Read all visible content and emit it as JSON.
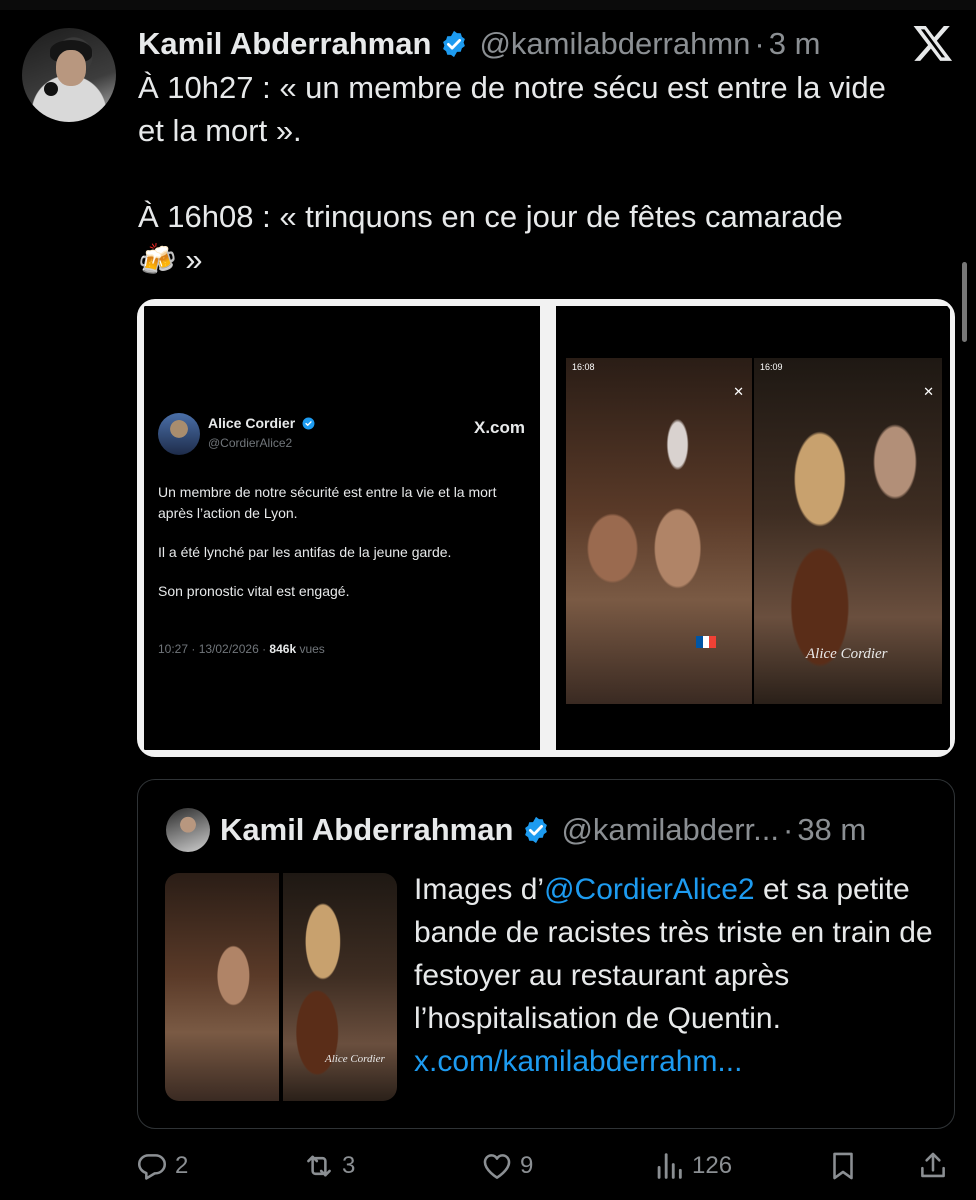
{
  "tweet": {
    "author_name": "Kamil Abderrahman",
    "handle": "@kamilabderrahmn",
    "separator": "·",
    "time": "3 m",
    "text_line1": "À 10h27 : « un membre de notre sécu est entre la vide",
    "text_line2": "et la mort ».",
    "text_line3": "À 16h08 : « trinquons en ce jour de fêtes camarade",
    "text_line4": "🍻 »"
  },
  "media": {
    "left_card": {
      "author_name": "Alice Cordier",
      "handle": "@CordierAlice2",
      "source": "X.com",
      "paragraph1": "Un membre de notre sécurité est entre la vie et la mort après l’action de Lyon.",
      "paragraph2": "Il a été lynché par les antifas de la jeune garde.",
      "paragraph3": "Son pronostic vital est engagé.",
      "meta_prefix": "10:27 · 13/02/2026 · ",
      "views_count": "846k",
      "views_suffix": " vues"
    },
    "right_photos": {
      "story_time_a": "16:08",
      "story_time_b": "16:09",
      "watermark": "Alice Cordier"
    }
  },
  "quoted_tweet": {
    "author_name": "Kamil Abderrahman",
    "handle": "@kamilabderr...",
    "separator": "·",
    "time": "38 m",
    "text_prefix": "Images d’",
    "mention": "@CordierAlice2",
    "text_rest": " et sa petite bande de racistes très triste en train de festoyer au restaurant après l’hospitalisation de Quentin.",
    "link": "x.com/kamilabderrahm...",
    "image_watermark": "Alice Cordier"
  },
  "actions": {
    "replies": "2",
    "reposts": "3",
    "likes": "9",
    "views": "126"
  },
  "colors": {
    "background": "#000000",
    "text": "#e7e9ea",
    "muted": "#8b8f93",
    "verified": "#1d9bf0",
    "link": "#1d9bf0"
  }
}
